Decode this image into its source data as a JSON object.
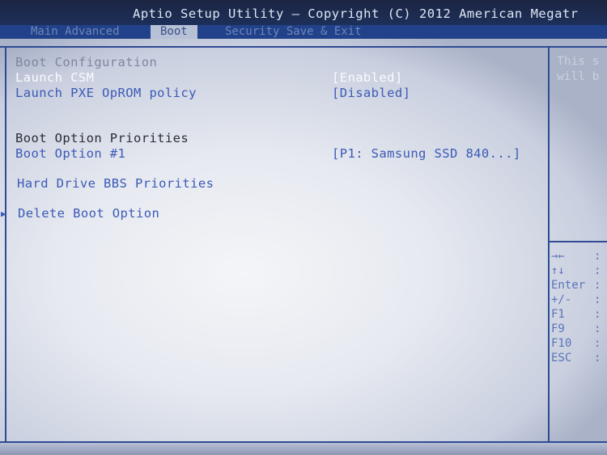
{
  "header": {
    "title": "Aptio Setup Utility – Copyright (C) 2012 American Megatr",
    "tabs": [
      {
        "label": "Main   Advanced",
        "active": false
      },
      {
        "label": "Boot",
        "active": true
      },
      {
        "label": "Security   Save & Exit",
        "active": false
      }
    ]
  },
  "main": {
    "section_boot_config": "Boot Configuration",
    "launch_csm": {
      "label": "Launch CSM",
      "value": "[Enabled]"
    },
    "launch_pxe": {
      "label": "Launch PXE OpROM policy",
      "value": "[Disabled]"
    },
    "section_priorities": "Boot Option Priorities",
    "boot_option_1": {
      "label": "Boot Option #1",
      "value": "[P1: Samsung SSD 840...]"
    },
    "hdd_bbs": "Hard Drive BBS Priorities",
    "delete_boot": "Delete Boot Option",
    "submenu_arrow": "▶"
  },
  "help_panel": {
    "line1": "This s",
    "line2": "will b"
  },
  "keys": [
    {
      "key": "→←",
      "sep": ":"
    },
    {
      "key": "↑↓",
      "sep": ":"
    },
    {
      "key": "Enter",
      "sep": ":"
    },
    {
      "key": "+/-",
      "sep": ":"
    },
    {
      "key": "F1",
      "sep": ":"
    },
    {
      "key": "F9",
      "sep": ":"
    },
    {
      "key": "F10",
      "sep": ":"
    },
    {
      "key": "ESC",
      "sep": ":"
    }
  ],
  "colors": {
    "frame": "#2e4a93",
    "header_bg": "#1b2542",
    "tab_bar": "#21418a",
    "selected_text": "#fbfcff",
    "option_text": "#3b5ab6"
  }
}
